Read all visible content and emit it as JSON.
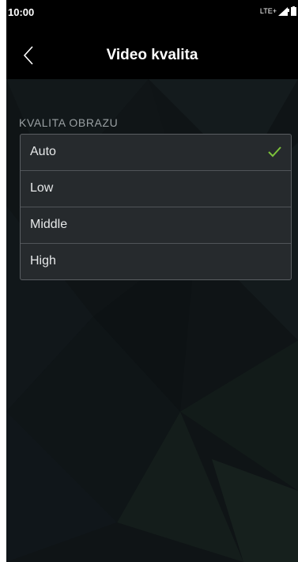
{
  "status_bar": {
    "time": "10:00",
    "network": "LTE+",
    "signal_icon": "signal-icon",
    "battery_icon": "battery-icon"
  },
  "header": {
    "title": "Video kvalita",
    "back_icon": "chevron-left-icon"
  },
  "section": {
    "label": "KVALITA OBRAZU",
    "options": [
      {
        "label": "Auto",
        "selected": true
      },
      {
        "label": "Low",
        "selected": false
      },
      {
        "label": "Middle",
        "selected": false
      },
      {
        "label": "High",
        "selected": false
      }
    ]
  },
  "colors": {
    "check": "#7cc23a",
    "background": "#0f1416",
    "header": "#000000"
  }
}
